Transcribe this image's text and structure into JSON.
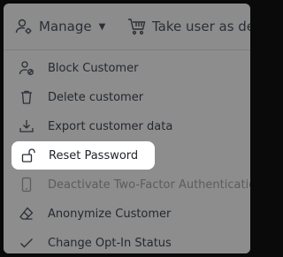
{
  "toolbar": {
    "manage_label": "Manage",
    "take_label": "Take user as del"
  },
  "menu": {
    "items": [
      {
        "label": "Block Customer",
        "icon": "user-block-icon"
      },
      {
        "label": "Delete customer",
        "icon": "trash-icon"
      },
      {
        "label": "Export customer data",
        "icon": "download-icon"
      },
      {
        "label": "Reset Password",
        "icon": "unlock-icon"
      },
      {
        "label": "Deactivate Two-Factor Authentication",
        "icon": "phone-icon"
      },
      {
        "label": "Anonymize Customer",
        "icon": "eraser-icon"
      },
      {
        "label": "Change Opt-In Status",
        "icon": "check-icon"
      }
    ]
  }
}
